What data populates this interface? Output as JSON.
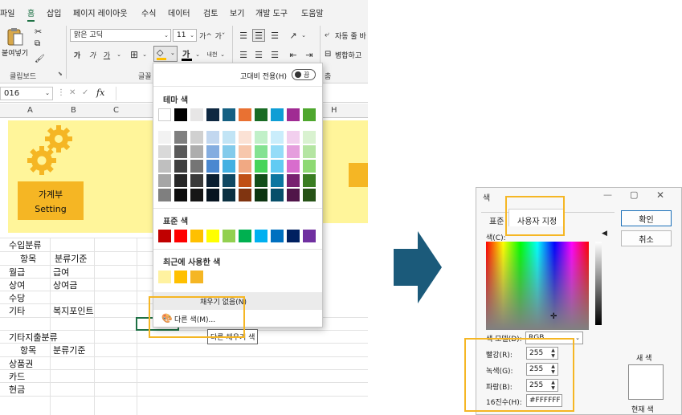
{
  "excel": {
    "menu": [
      "파일",
      "홈",
      "삽입",
      "페이지 레이아웃",
      "수식",
      "데이터",
      "검토",
      "보기",
      "개발 도구",
      "도움말"
    ],
    "active_menu": "홈",
    "ribbon": {
      "paste_label": "붙여넣기",
      "clipboard_label": "클립보드",
      "font_group_label": "글꼴",
      "font_name": "맑은 고딕",
      "font_size": "11",
      "grow_font": "가^",
      "shrink_font": "가ˇ",
      "bold": "가",
      "italic": "가",
      "underline": "가",
      "font_color_glyph": "가",
      "phonetic": "내천",
      "wrap_text": "자동 줄 바",
      "merge": "병합하고",
      "align_group_tail": "춤"
    },
    "name_box": "016",
    "fx": "fx",
    "columns": [
      "A",
      "B",
      "C",
      "H"
    ],
    "banner": {
      "line1": "가계부",
      "line2": "Setting"
    },
    "cells": {
      "income_title": "수입분류",
      "col_item": "항목",
      "col_criteria": "분류기준",
      "r1a": "월급",
      "r1b": "급여",
      "r2a": "상여",
      "r2b": "상여금",
      "r3a": "수당",
      "r4a": "기타",
      "r4b": "복지포인트",
      "expense_title": "기타지출분류",
      "col_item2": "항목",
      "col_criteria2": "분류기준",
      "e1": "상품권",
      "e2": "카드",
      "e3": "현금"
    }
  },
  "palette": {
    "high_contrast_label": "고대비 전용(H)",
    "toggle_state": "끔",
    "theme_label": "테마 색",
    "standard_label": "표준 색",
    "recent_label": "최근에 사용한 색",
    "no_fill": "채우기 없음(N)",
    "more_colors": "다른 색(M)...",
    "tooltip": "다른 채우기 색",
    "theme_row": [
      "#ffffff",
      "#000000",
      "#e7e6e6",
      "#44546a",
      "#4472c4",
      "#ed7d31",
      "#a5a5a5",
      "#ffc000",
      "#5b9bd5",
      "#70ad47"
    ],
    "theme_shades": [
      [
        "#f2f2f2",
        "#808080",
        "#d0cece",
        "#d6dce4",
        "#dae3f3",
        "#fbe5d6",
        "#ededed",
        "#fff2cc",
        "#deebf7",
        "#e2f0d9"
      ],
      [
        "#d9d9d9",
        "#595959",
        "#aeaaaa",
        "#adb9ca",
        "#b4c7e7",
        "#f8cbad",
        "#dbdbdb",
        "#ffe699",
        "#bdd7ee",
        "#c5e0b4"
      ],
      [
        "#bfbfbf",
        "#404040",
        "#757171",
        "#8497b0",
        "#8faadc",
        "#f4b183",
        "#c9c9c9",
        "#ffd966",
        "#9dc3e6",
        "#a9d18e"
      ],
      [
        "#a6a6a6",
        "#262626",
        "#3b3838",
        "#333f50",
        "#2f5597",
        "#c55a11",
        "#7b7b7b",
        "#bf9000",
        "#2e75b6",
        "#548235"
      ],
      [
        "#7f7f7f",
        "#0d0d0d",
        "#171616",
        "#222a35",
        "#1f3864",
        "#843c0c",
        "#525252",
        "#7f6000",
        "#1f4e79",
        "#385723"
      ]
    ],
    "theme_row_shown": [
      "#ffffff",
      "#000000",
      "#e7e6e6",
      "#0e2841",
      "#156082",
      "#e97132",
      "#196b24",
      "#0f9ed5",
      "#a02b93",
      "#4ea72e"
    ],
    "theme_shades_shown": [
      [
        "#f2f2f2",
        "#7f7f7f",
        "#d0d0d0",
        "#c2d7ef",
        "#c1e4f5",
        "#fbe2d5",
        "#c1f0c8",
        "#caedfb",
        "#f2cfee",
        "#d9f2d0"
      ],
      [
        "#d9d9d9",
        "#595959",
        "#adadad",
        "#84ade0",
        "#83cbeb",
        "#f7c7ac",
        "#84e291",
        "#94dcf8",
        "#e59edd",
        "#b4e5a2"
      ],
      [
        "#bfbfbf",
        "#3f3f3f",
        "#757575",
        "#4a88d0",
        "#44b1e2",
        "#f1a983",
        "#47d45a",
        "#61cbf3",
        "#d86dcd",
        "#8ed973"
      ],
      [
        "#a6a6a6",
        "#262626",
        "#3a3a3a",
        "#0a1e31",
        "#104862",
        "#c04f15",
        "#124e1a",
        "#0b76a0",
        "#782170",
        "#3a7d22"
      ],
      [
        "#7f7f7f",
        "#0d0d0d",
        "#161616",
        "#071420",
        "#0b3041",
        "#803410",
        "#0c3411",
        "#074f6a",
        "#501549",
        "#275317"
      ]
    ],
    "standard_row": [
      "#c00000",
      "#ff0000",
      "#ffc000",
      "#ffff00",
      "#92d050",
      "#00b050",
      "#00b0f0",
      "#0070c0",
      "#002060",
      "#7030a0"
    ],
    "recent_row": [
      "#fff2a0",
      "#ffc000",
      "#f5b624"
    ]
  },
  "dialog": {
    "title": "색",
    "tab_standard": "표준",
    "tab_custom": "사용자 지정",
    "ok": "확인",
    "cancel": "취소",
    "colors_label": "색(C):",
    "model_label": "색 모델(D):",
    "model_value": "RGB",
    "red_label": "빨강(R):",
    "green_label": "녹색(G):",
    "blue_label": "파랑(B):",
    "hex_label": "16진수(H):",
    "red": "255",
    "green": "255",
    "blue": "255",
    "hex": "#FFFFFF",
    "new_label": "새 색",
    "current_label": "현재 색"
  },
  "colors": {
    "accent_green": "#1e7145",
    "highlight": "#f5b624",
    "banner_yellow": "#fff59a",
    "arrow_blue": "#1b5a7a"
  }
}
